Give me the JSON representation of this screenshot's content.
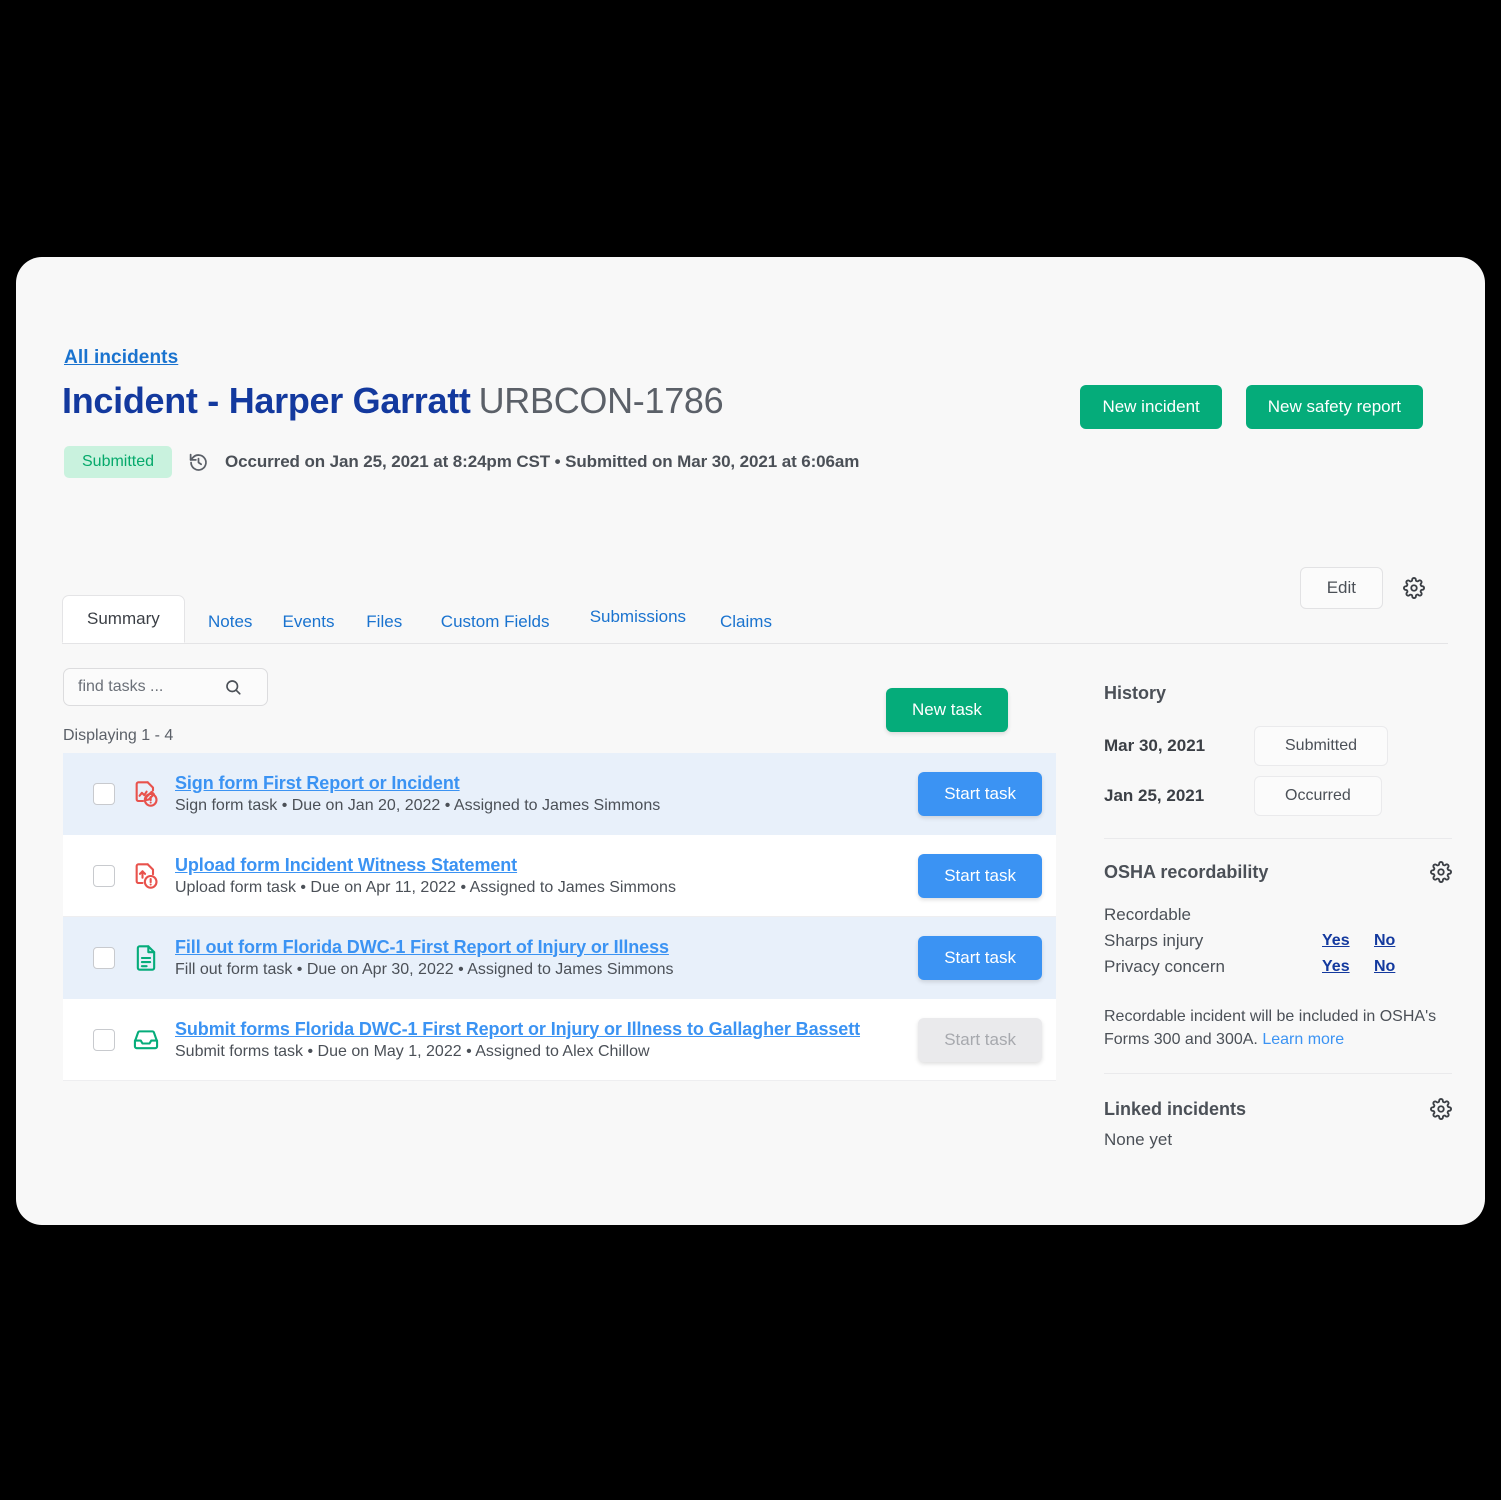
{
  "header": {
    "breadcrumb": "All incidents",
    "title_main": "Incident - Harper Garratt",
    "title_id": "URBCON-1786",
    "status_badge": "Submitted",
    "meta_text": "Occurred on Jan 25, 2021 at 8:24pm CST • Submitted on Mar 30, 2021 at 6:06am",
    "new_incident_label": "New incident",
    "new_safety_report_label": "New safety report",
    "edit_label": "Edit"
  },
  "tabs": [
    {
      "label": "Summary",
      "active": true
    },
    {
      "label": "Notes",
      "active": false
    },
    {
      "label": "Events",
      "active": false
    },
    {
      "label": "Files",
      "active": false
    },
    {
      "label": "Custom Fields",
      "active": false
    },
    {
      "label": "Submissions",
      "active": false
    },
    {
      "label": "Claims",
      "active": false
    }
  ],
  "toolbar": {
    "search_placeholder": "find tasks ...",
    "search_value": "",
    "displaying": "Displaying 1 - 4",
    "new_task_label": "New task"
  },
  "tasks": [
    {
      "title": "Sign form First Report or Incident",
      "subtitle": "Sign form task • Due on Jan 20, 2022 • Assigned to James Simmons",
      "icon": "sign-form-alert-icon",
      "icon_color": "#e8524c",
      "action_label": "Start task",
      "action_disabled": false,
      "highlighted": true
    },
    {
      "title": "Upload form Incident Witness Statement",
      "subtitle": "Upload form task • Due on Apr 11, 2022 • Assigned to James Simmons",
      "icon": "upload-form-alert-icon",
      "icon_color": "#e8524c",
      "action_label": "Start task",
      "action_disabled": false,
      "highlighted": false
    },
    {
      "title": "Fill out form Florida DWC-1 First Report of Injury or Illness",
      "subtitle": "Fill out form task • Due on Apr 30, 2022 • Assigned to James Simmons",
      "icon": "document-lines-icon",
      "icon_color": "#05ac7a",
      "action_label": "Start task",
      "action_disabled": false,
      "highlighted": true
    },
    {
      "title": "Submit forms Florida DWC-1 First Report or Injury or Illness to Gallagher Bassett",
      "subtitle": "Submit forms task • Due on May 1, 2022 • Assigned to Alex Chillow",
      "icon": "inbox-tray-icon",
      "icon_color": "#05ac7a",
      "action_label": "Start task",
      "action_disabled": true,
      "highlighted": false
    }
  ],
  "sidebar": {
    "history": {
      "title": "History",
      "rows": [
        {
          "date": "Mar 30, 2021",
          "status": "Submitted"
        },
        {
          "date": "Jan 25, 2021",
          "status": "Occurred"
        }
      ]
    },
    "osha": {
      "title": "OSHA recordability",
      "rows": [
        {
          "label": "Recordable",
          "yes": "",
          "no": ""
        },
        {
          "label": "Sharps injury",
          "yes": "Yes",
          "no": "No"
        },
        {
          "label": "Privacy concern",
          "yes": "Yes",
          "no": "No"
        }
      ],
      "note": "Recordable incident will be included in OSHA's Forms 300 and 300A.",
      "note_link": "Learn more"
    },
    "linked": {
      "title": "Linked incidents",
      "empty": "None yet"
    }
  },
  "colors": {
    "green": "#05ac7a",
    "blue": "#3b93f3",
    "link": "#1a73cf",
    "navy": "#13399e",
    "red": "#e8524c",
    "row_highlight": "#e8f0fa"
  }
}
